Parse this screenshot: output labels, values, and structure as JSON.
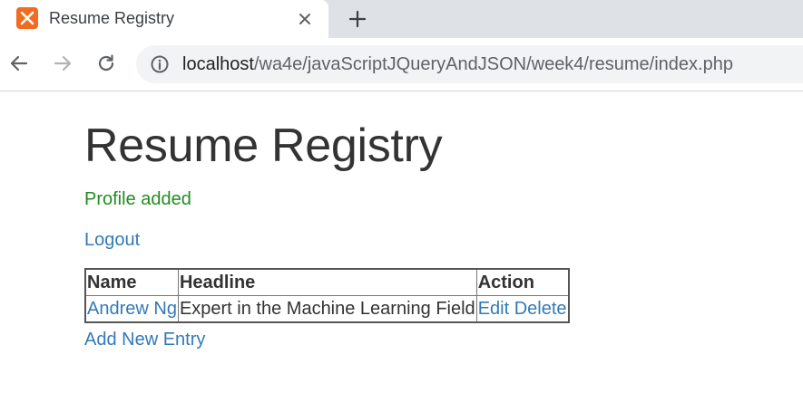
{
  "browser": {
    "tab": {
      "title": "Resume Registry",
      "favicon": "xampp-icon"
    },
    "url": {
      "host": "localhost",
      "path": "/wa4e/javaScriptJQueryAndJSON/week4/resume/index.php"
    }
  },
  "page": {
    "title": "Resume Registry",
    "flash_message": "Profile added",
    "logout_label": "Logout",
    "table": {
      "headers": [
        "Name",
        "Headline",
        "Action"
      ],
      "rows": [
        {
          "name": "Andrew Ng",
          "headline": "Expert in the Machine Learning Field",
          "edit_label": "Edit",
          "delete_label": "Delete"
        }
      ]
    },
    "add_new_label": "Add New Entry"
  },
  "colors": {
    "link": "#337ab7",
    "flash": "#228b22",
    "favicon": "#f26b21"
  }
}
